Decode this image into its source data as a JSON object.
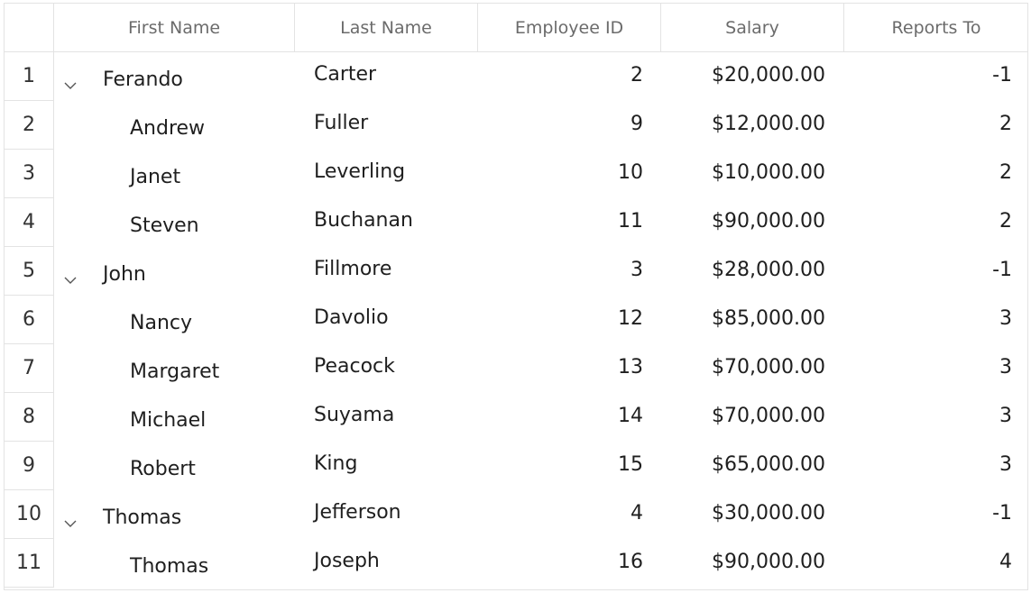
{
  "columns": {
    "first_name": "First Name",
    "last_name": "Last Name",
    "employee_id": "Employee ID",
    "salary": "Salary",
    "reports_to": "Reports To"
  },
  "rows": [
    {
      "num": "1",
      "first": "Ferando",
      "last": "Carter",
      "emp": "2",
      "salary": "$20,000.00",
      "reports": "-1",
      "level": "parent",
      "expanded": true
    },
    {
      "num": "2",
      "first": "Andrew",
      "last": "Fuller",
      "emp": "9",
      "salary": "$12,000.00",
      "reports": "2",
      "level": "child",
      "expanded": false
    },
    {
      "num": "3",
      "first": "Janet",
      "last": "Leverling",
      "emp": "10",
      "salary": "$10,000.00",
      "reports": "2",
      "level": "child",
      "expanded": false
    },
    {
      "num": "4",
      "first": "Steven",
      "last": "Buchanan",
      "emp": "11",
      "salary": "$90,000.00",
      "reports": "2",
      "level": "child",
      "expanded": false
    },
    {
      "num": "5",
      "first": "John",
      "last": "Fillmore",
      "emp": "3",
      "salary": "$28,000.00",
      "reports": "-1",
      "level": "parent",
      "expanded": true
    },
    {
      "num": "6",
      "first": "Nancy",
      "last": "Davolio",
      "emp": "12",
      "salary": "$85,000.00",
      "reports": "3",
      "level": "child",
      "expanded": false
    },
    {
      "num": "7",
      "first": "Margaret",
      "last": "Peacock",
      "emp": "13",
      "salary": "$70,000.00",
      "reports": "3",
      "level": "child",
      "expanded": false
    },
    {
      "num": "8",
      "first": "Michael",
      "last": "Suyama",
      "emp": "14",
      "salary": "$70,000.00",
      "reports": "3",
      "level": "child",
      "expanded": false
    },
    {
      "num": "9",
      "first": "Robert",
      "last": "King",
      "emp": "15",
      "salary": "$65,000.00",
      "reports": "3",
      "level": "child",
      "expanded": false
    },
    {
      "num": "10",
      "first": "Thomas",
      "last": "Jefferson",
      "emp": "4",
      "salary": "$30,000.00",
      "reports": "-1",
      "level": "parent",
      "expanded": true
    },
    {
      "num": "11",
      "first": "Thomas",
      "last": "Joseph",
      "emp": "16",
      "salary": "$90,000.00",
      "reports": "4",
      "level": "child",
      "expanded": false
    }
  ],
  "icons": {
    "expander": "chevron-down-icon"
  },
  "colors": {
    "grid_line": "#e3e3e3",
    "header_text": "#6b6b6b",
    "cell_text": "#1f1f1f"
  }
}
